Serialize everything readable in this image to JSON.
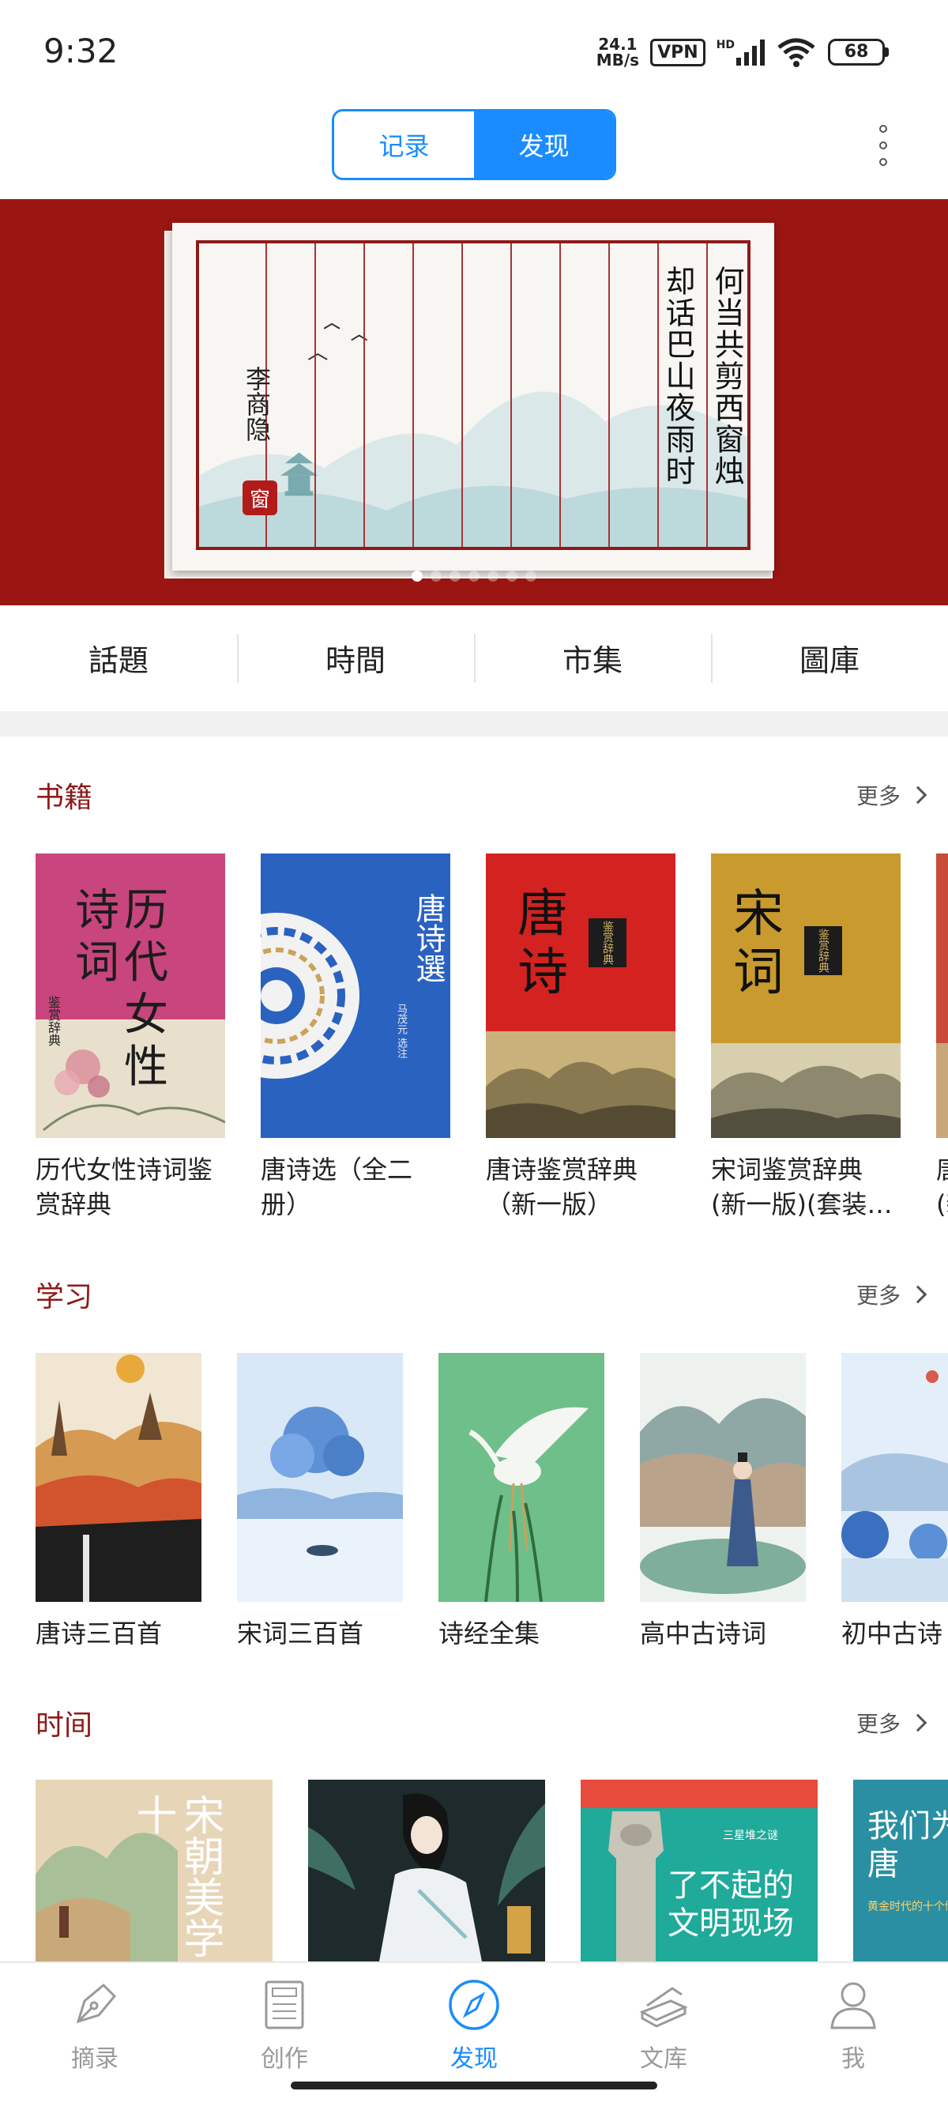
{
  "status_bar": {
    "time": "9:32",
    "net_speed_value": "24.1",
    "net_speed_unit": "MB/s",
    "vpn": "VPN",
    "hd": "HD",
    "battery": "68"
  },
  "header": {
    "tabs": [
      {
        "label": "记录",
        "active": false
      },
      {
        "label": "发现",
        "active": true
      }
    ]
  },
  "banner": {
    "poem_lines": [
      "何当共剪西窗烛",
      "却话巴山夜雨时"
    ],
    "author": "李商隐",
    "seal": "窗",
    "page_count": 7,
    "current_page": 0
  },
  "categories": [
    "話題",
    "時間",
    "市集",
    "圖庫"
  ],
  "sections": {
    "books": {
      "title": "书籍",
      "more": "更多",
      "items": [
        {
          "line1": "历代女性诗词鉴",
          "line2": "赏辞典",
          "cover_text": [
            "诗",
            "词",
            "历",
            "代",
            "女",
            "性"
          ],
          "cover_small": "鉴赏辞典"
        },
        {
          "line1": "唐诗选（全二",
          "line2": "册）",
          "cover_text": [
            "唐",
            "诗",
            "選"
          ],
          "cover_small": "马茂元 选注"
        },
        {
          "line1": "唐诗鉴赏辞典",
          "line2": "（新一版）",
          "cover_text": [
            "唐",
            "诗"
          ],
          "cover_small": "鉴赏辞典"
        },
        {
          "line1": "宋词鉴赏辞典",
          "line2": "(新一版)(套装…",
          "cover_text": [
            "宋",
            "词"
          ],
          "cover_small": "鉴赏辞典"
        },
        {
          "line1": "唐",
          "line2": "(新",
          "cover_text": [],
          "cover_small": ""
        }
      ]
    },
    "study": {
      "title": "学习",
      "more": "更多",
      "items": [
        {
          "label": "唐诗三百首"
        },
        {
          "label": "宋词三百首"
        },
        {
          "label": "诗经全集"
        },
        {
          "label": "高中古诗词"
        },
        {
          "label": "初中古诗"
        }
      ]
    },
    "time": {
      "title": "时间",
      "more": "更多",
      "items": [
        {
          "cover_text": "宋朝美学十"
        },
        {
          "cover_text": ""
        },
        {
          "cover_text": "了不起的文明现场",
          "cover_small": "三星堆之谜"
        },
        {
          "cover_text": "我们为爱唐",
          "cover_small": "黄金时代的十个侧面"
        }
      ]
    }
  },
  "bottom_nav": [
    {
      "label": "摘录",
      "icon": "pen-nib-icon",
      "active": false
    },
    {
      "label": "创作",
      "icon": "document-icon",
      "active": false
    },
    {
      "label": "发现",
      "icon": "compass-icon",
      "active": true
    },
    {
      "label": "文库",
      "icon": "books-icon",
      "active": false
    },
    {
      "label": "我",
      "icon": "person-icon",
      "active": false
    }
  ],
  "colors": {
    "accent": "#1a8cff",
    "section_title": "#8e1a1a",
    "banner_bg": "#9b1612"
  }
}
